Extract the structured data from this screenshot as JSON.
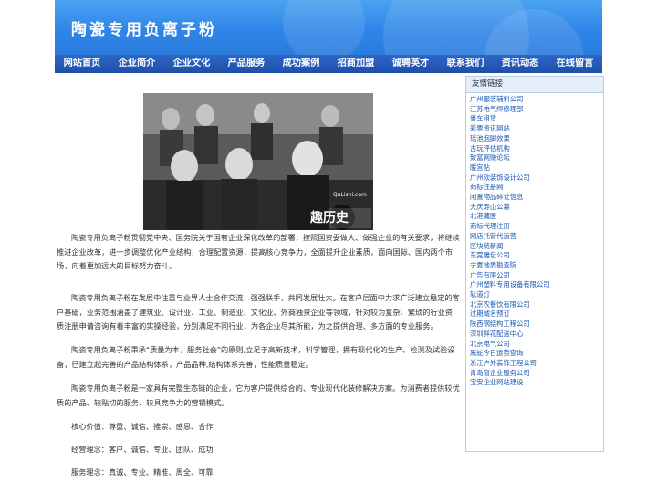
{
  "banner": {
    "title": "陶瓷专用负离子粉"
  },
  "nav": [
    "网站首页",
    "企业简介",
    "企业文化",
    "产品服务",
    "成功案例",
    "招商加盟",
    "诚聘英才",
    "联系我们",
    "资讯动态",
    "在线留言"
  ],
  "photo": {
    "watermark_site": "QuLishi.com",
    "watermark_logo": "趣历史"
  },
  "paragraphs": [
    "陶瓷专用负离子粉贯彻党中央、国务院关于国有企业深化改革的部署，按照国资委做大、做强企业的有关要求，将继续推进企业改革，进一步调整优化产业结构，合理配置资源，提高核心竞争力，全面提升企业素质，面向国际、国内两个市场，向着更加远大的目标努力奋斗。",
    "陶瓷专用负离子粉在发展中注重与业界人士合作交流，强强联手，共同发展壮大。在客户层面中力求广泛建立稳定的客户基础，业务范围涵盖了建筑业、设计业、工业、制造业、文化业、外商独资企业等领域，针对较为复杂、繁琐的行业资质注册申请咨询有着丰富的实操经验，分别满足不同行业，为各企业尽其所能，为之提供合理、多方面的专业服务。",
    "陶瓷专用负离子粉秉承“质量为本，服务社会”的原则,立足于高新技术，科学管理，拥有现代化的生产、检测及试验设备，已建立起完善的产品结构体系，产品品种,结构体系完善，性能质量稳定。",
    "陶瓷专用负离子粉是一家具有完整生态链的企业，它为客户提供综合的、专业现代化装修解决方案。为消费者提供较优质的产品、较贴切的服务、较具竞争力的营销模式。",
    "核心价值：尊重、诚信、推崇、感恩、合作",
    "经营理念：客户、诚信、专业、团队、成功",
    "服务理念：真诚、专业、精准、周全、可靠"
  ],
  "sidebar": {
    "title": "友情链接",
    "links": [
      "广州服装辅料公司",
      "江苏电气焊修理部",
      "豪车租赁",
      "彩票资讯网站",
      "瑶池泡脚效果",
      "古玩评估机构",
      "致富网赚论坛",
      "暖宫贴",
      "广州软装饰设计公司",
      "商标注册网",
      "闲置物品碎让信息",
      "大庆寿山公墓",
      "北港藏医",
      "商标代理注册",
      "网店托管代运营",
      "区块链新闻",
      "东莞雕包公司",
      "宁夏地质勘查院",
      "广告有限公司",
      "广州塑料专用设备有限公司",
      "轨道灯",
      "北京农餐饮有限公司",
      "过期域名预订",
      "陕西钢结构工程公司",
      "深圳鲜花配送中心",
      "北京电气公司",
      "属蛇今日运势查询",
      "浙江户外装饰工程公司",
      "青岛窗企业服务公司",
      "宝安企业网站建设"
    ]
  },
  "colors": {
    "banner": "#3a92ec",
    "nav": "#2458b6",
    "link": "#1a57b0",
    "sidebar_border": "#b9cde6"
  }
}
